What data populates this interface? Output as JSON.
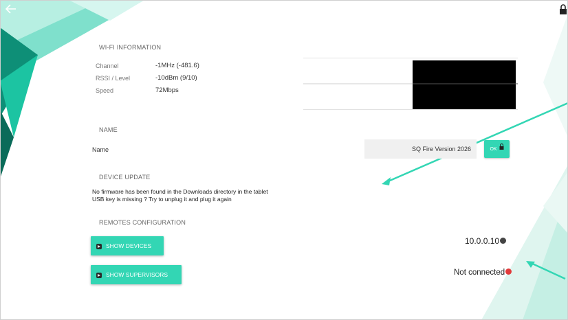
{
  "header": {
    "back_icon": "back-arrow-icon",
    "lock_icon": "lock-icon"
  },
  "wifi": {
    "title": "WI-FI INFORMATION",
    "rows": [
      {
        "label": "Channel",
        "value": "-1MHz (-481.6)"
      },
      {
        "label": "RSSI / Level",
        "value": "-10dBm (9/10)"
      },
      {
        "label": "Speed",
        "value": "72Mbps"
      }
    ]
  },
  "name_section": {
    "title": "NAME",
    "label": "Name",
    "value": "SQ Fire Version 2026",
    "ok_label": "OK"
  },
  "device_update": {
    "title": "DEVICE UPDATE",
    "line1": "No firmware has been found in the Downloads directory in the tablet",
    "line2": "USB key is missing ? Try to unplug it and plug it again"
  },
  "remotes": {
    "title": "REMOTES CONFIGURATION",
    "show_devices_label": "SHOW DEVICES",
    "show_supervisors_label": "SHOW SUPERVISORS",
    "ip": "10.0.0.10",
    "status": "Not connected"
  },
  "colors": {
    "accent": "#33d6b4",
    "dark_accent": "#0f8a73",
    "error": "#e23b3b"
  }
}
